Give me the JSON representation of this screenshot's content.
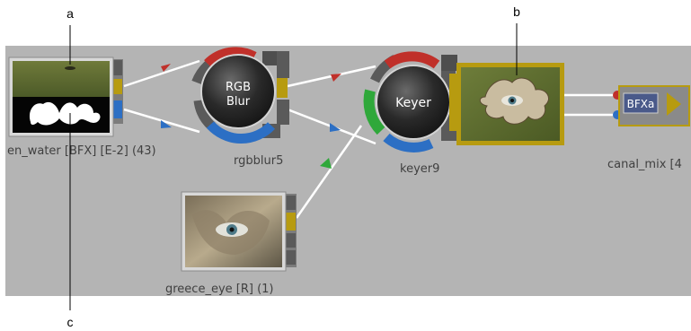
{
  "callouts": {
    "a": "a",
    "b": "b",
    "c": "c"
  },
  "nodes": {
    "source": {
      "label": "en_water [BFX]  [E-2] (43)"
    },
    "rgbblur": {
      "title_line1": "RGB",
      "title_line2": "Blur",
      "label": "rgbblur5"
    },
    "keyer": {
      "title": "Keyer",
      "label": "keyer9"
    },
    "greece_eye": {
      "label": "greece_eye [R] (1)"
    },
    "bfx": {
      "badge": "BFXa"
    },
    "canal_mix": {
      "label": "canal_mix [4"
    }
  },
  "colors": {
    "background": "#b4b4b4",
    "red": "#c0302a",
    "green": "#2fa83a",
    "blue": "#2c6fc4",
    "yellow": "#b79b10",
    "link": "#ffffff",
    "node_label": "#404040"
  }
}
